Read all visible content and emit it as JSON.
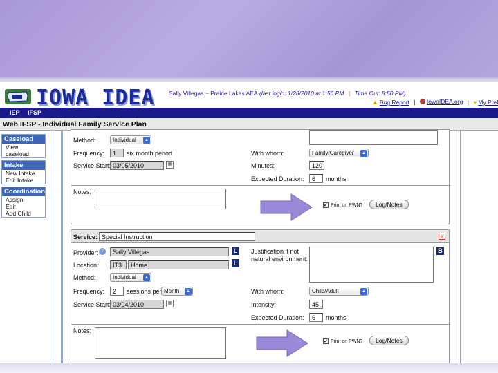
{
  "app": {
    "title": "IOWA IDEA",
    "user_info": "Sally Villegas ~ Prairie Lakes AEA",
    "last_login": "(last login: 1/28/2010 at 1:56 PM",
    "timeout": "Time Out: 8:50 PM)",
    "links": {
      "bug_report": "Bug Report",
      "iowaidea": "IowaIDEA.org",
      "prefs": "My Preferen"
    }
  },
  "nav": {
    "iep": "IEP",
    "ifsp": "IFSP"
  },
  "page_title": "Web IFSP - Individual Family Service Plan",
  "sidebar": {
    "sections": [
      {
        "title": "Caseload",
        "items": [
          "View caseload"
        ]
      },
      {
        "title": "Intake",
        "items": [
          "New Intake",
          "Edit Intake"
        ]
      },
      {
        "title": "Coordination",
        "items": [
          "Assign",
          "Edit",
          "Add Child"
        ]
      }
    ]
  },
  "service1": {
    "method_label": "Method:",
    "method_value": "Individual",
    "frequency_label": "Frequency:",
    "frequency_value": "1",
    "frequency_unit": "six month period",
    "start_label": "Service Start:",
    "start_value": "03/05/2010",
    "with_whom_label": "With whom:",
    "with_whom_value": "Family/Caregiver",
    "minutes_label": "Minutes:",
    "minutes_value": "120",
    "duration_label": "Expected Duration:",
    "duration_value": "6",
    "duration_unit": "months",
    "notes_label": "Notes:",
    "print_label": "Print on PWN?",
    "log_button": "Log/Notes"
  },
  "service2": {
    "service_label": "Service:",
    "service_value": "Special Instruction",
    "provider_label": "Provider:",
    "provider_value": "Sally Villegas",
    "location_label": "Location:",
    "location_code": "IT3",
    "location_value": "Home",
    "justification_label_1": "Justification if not",
    "justification_label_2": "natural environment:",
    "method_label": "Method:",
    "method_value": "Individual",
    "frequency_label": "Frequency:",
    "frequency_value": "2",
    "frequency_per": "sessions per",
    "frequency_unit": "Month",
    "start_label": "Service Start:",
    "start_value": "03/04/2010",
    "with_whom_label": "With whom:",
    "with_whom_value": "Child/Adult",
    "intensity_label": "Intensity:",
    "intensity_value": "45",
    "duration_label": "Expected Duration:",
    "duration_value": "6",
    "duration_unit": "months",
    "notes_label": "Notes:",
    "print_label": "Print on PWN?",
    "log_button": "Log/Notes"
  },
  "glyphs": {
    "l": "L",
    "b": "B",
    "x": "X",
    "check": "✔",
    "info": "?",
    "arrow": "▲"
  },
  "colors": {
    "nav": "#1a1a8a",
    "sidebar_head": "#3e66b8",
    "arrow": "#9a88d8",
    "deco": "#a898d8"
  }
}
